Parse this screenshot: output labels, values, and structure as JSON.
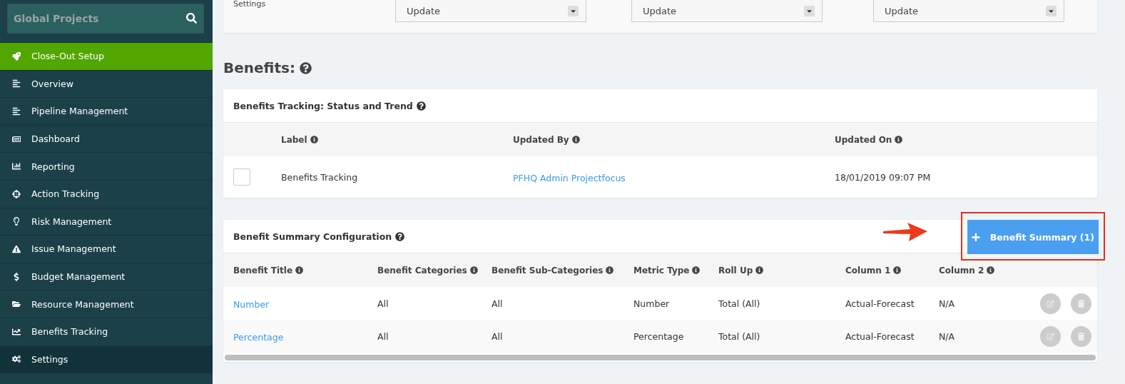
{
  "sidebar": {
    "search": {
      "placeholder": "Global Projects"
    },
    "items": [
      {
        "label": "Close-Out Setup",
        "selected": true
      },
      {
        "label": "Overview",
        "selected": false
      },
      {
        "label": "Pipeline Management",
        "selected": false
      },
      {
        "label": "Dashboard",
        "selected": false
      },
      {
        "label": "Reporting",
        "selected": false
      },
      {
        "label": "Action Tracking",
        "selected": false
      },
      {
        "label": "Risk Management",
        "selected": false
      },
      {
        "label": "Issue Management",
        "selected": false
      },
      {
        "label": "Budget Management",
        "selected": false
      },
      {
        "label": "Resource Management",
        "selected": false
      },
      {
        "label": "Benefits Tracking",
        "selected": false
      },
      {
        "label": "Settings",
        "selected": false
      }
    ]
  },
  "settings_card": {
    "label": "Settings",
    "selects": [
      {
        "value": "Update"
      },
      {
        "value": "Update"
      },
      {
        "value": "Update"
      }
    ]
  },
  "section_title": "Benefits:",
  "tracking_card": {
    "title": "Benefits Tracking: Status and Trend",
    "columns": [
      "Label",
      "Updated By",
      "Updated On"
    ],
    "rows": [
      {
        "checked": false,
        "label": "Benefits Tracking",
        "updated_by": "PFHQ Admin Projectfocus",
        "updated_on": "18/01/2019 09:07 PM"
      }
    ]
  },
  "summary_card": {
    "title": "Benefit Summary Configuration",
    "add_button": "Benefit Summary (1)",
    "columns": [
      "Benefit Title",
      "Benefit Categories",
      "Benefit Sub-Categories",
      "Metric Type",
      "Roll Up",
      "Column 1",
      "Column 2"
    ],
    "rows": [
      [
        "Number",
        "All",
        "All",
        "Number",
        "Total (All)",
        "Actual-Forecast",
        "N/A"
      ],
      [
        "Percentage",
        "All",
        "All",
        "Percentage",
        "Total (All)",
        "Actual-Forecast",
        "N/A"
      ]
    ]
  }
}
